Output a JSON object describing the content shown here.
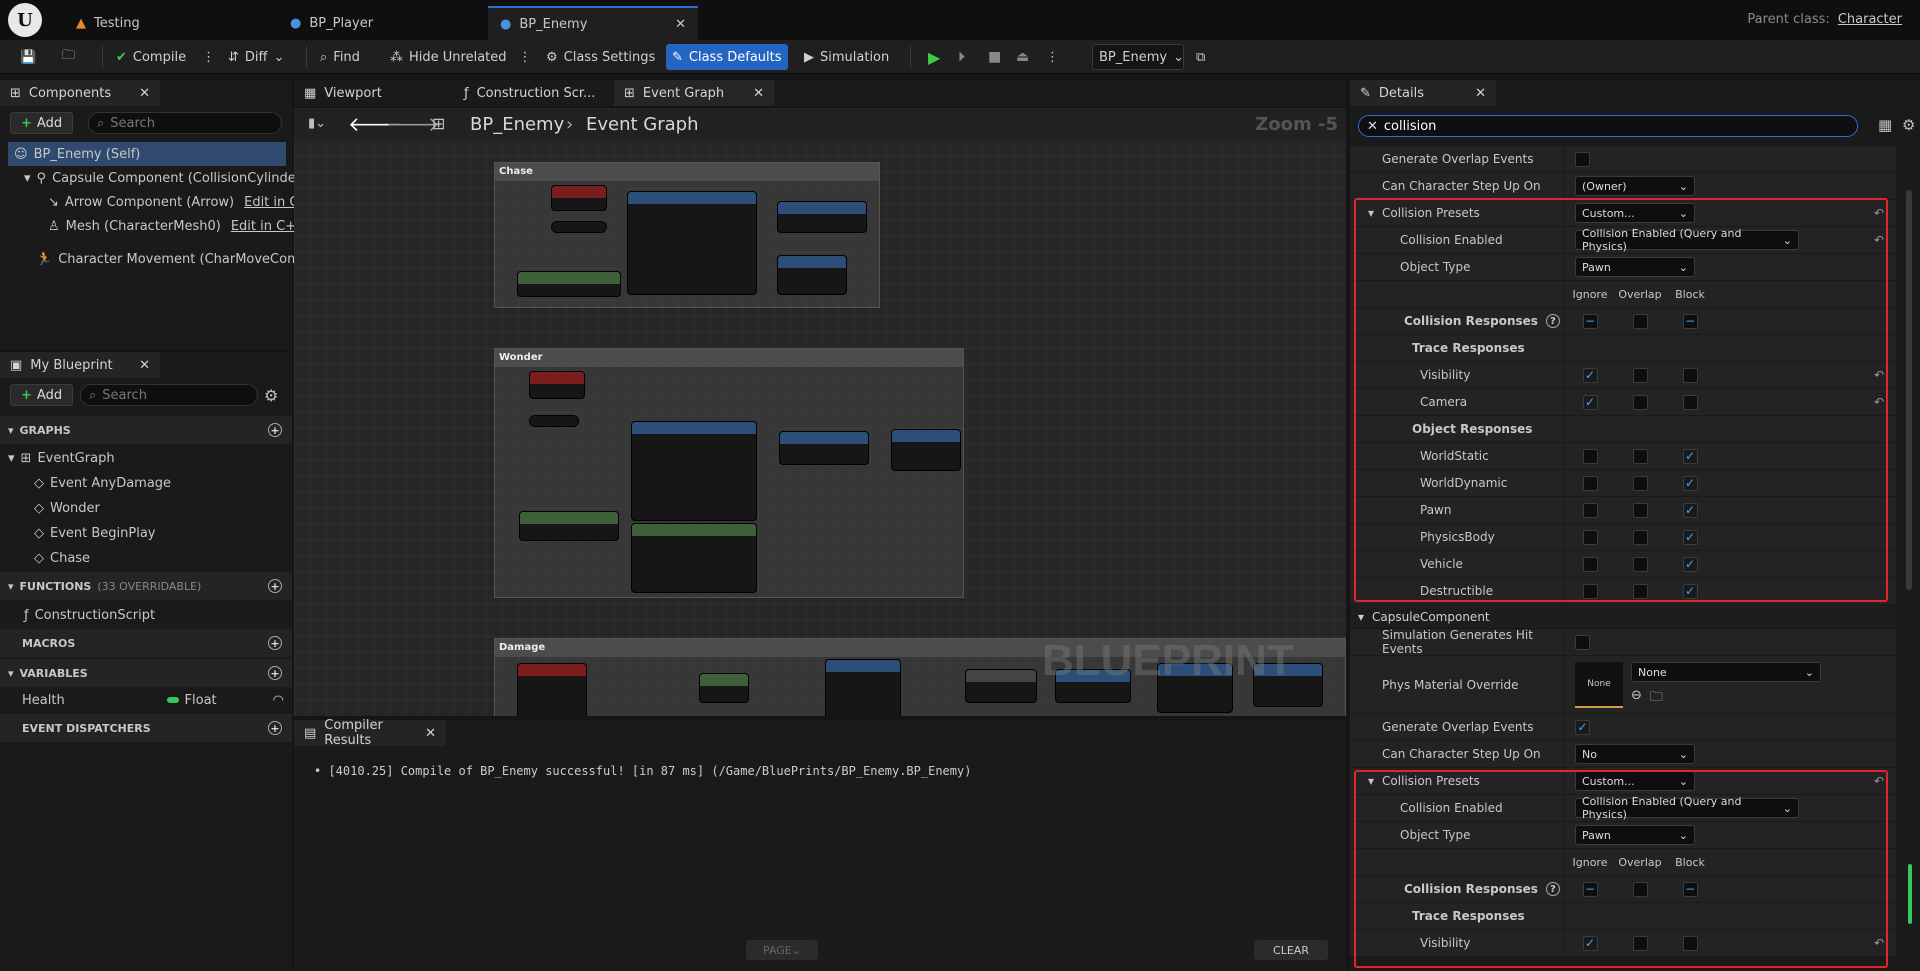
{
  "titlebar": {
    "tabs": [
      {
        "label": "Testing"
      },
      {
        "label": "BP_Player"
      },
      {
        "label": "BP_Enemy"
      }
    ],
    "parent_class_label": "Parent class:",
    "parent_class_value": "Character"
  },
  "toolbar": {
    "compile": "Compile",
    "diff": "Diff",
    "find": "Find",
    "hide_unrelated": "Hide Unrelated",
    "class_settings": "Class Settings",
    "class_defaults": "Class Defaults",
    "simulation": "Simulation",
    "debug_object": "BP_Enemy"
  },
  "components": {
    "tab": "Components",
    "add": "Add",
    "search_placeholder": "Search",
    "items": [
      {
        "label": "BP_Enemy (Self)"
      },
      {
        "label": "Capsule Component (CollisionCylinder)"
      },
      {
        "label": "Arrow Component (Arrow)",
        "link": "Edit in C++"
      },
      {
        "label": "Mesh (CharacterMesh0)",
        "link": "Edit in C++"
      },
      {
        "label": "Character Movement (CharMoveComp)"
      }
    ]
  },
  "my_blueprint": {
    "tab": "My Blueprint",
    "add": "Add",
    "search_placeholder": "Search",
    "graphs_header": "GRAPHS",
    "event_graph": "EventGraph",
    "events": [
      "Event AnyDamage",
      "Wonder",
      "Event BeginPlay",
      "Chase"
    ],
    "functions_header": "FUNCTIONS",
    "functions_note": "(33 OVERRIDABLE)",
    "functions": [
      "ConstructionScript"
    ],
    "macros_header": "MACROS",
    "variables_header": "VARIABLES",
    "variable": {
      "name": "Health",
      "type": "Float"
    },
    "dispatchers_header": "EVENT DISPATCHERS"
  },
  "graph_tabs": {
    "viewport": "Viewport",
    "construction": "Construction Scr...",
    "event_graph": "Event Graph"
  },
  "graph": {
    "breadcrumb_bp": "BP_Enemy",
    "breadcrumb_graph": "Event Graph",
    "zoom": "Zoom -5",
    "watermark": "BLUEPRINT",
    "comments": [
      "Chase",
      "Wonder",
      "Damage"
    ]
  },
  "compiler": {
    "tab": "Compiler Results",
    "message": "[4010.25] Compile of BP_Enemy successful! [in 87 ms] (/Game/BluePrints/BP_Enemy.BP_Enemy)",
    "page": "PAGE",
    "clear": "CLEAR"
  },
  "details": {
    "tab": "Details",
    "search_value": "collision",
    "rows_top": [
      {
        "name": "Generate Overlap Events"
      },
      {
        "name": "Can Character Step Up On",
        "value": "(Owner)"
      }
    ],
    "group1": {
      "presets_label": "Collision Presets",
      "presets_value": "Custom...",
      "enabled_label": "Collision Enabled",
      "enabled_value": "Collision Enabled (Query and Physics)",
      "object_type_label": "Object Type",
      "object_type_value": "Pawn",
      "col_ignore": "Ignore",
      "col_overlap": "Overlap",
      "col_block": "Block",
      "responses_label": "Collision Responses",
      "trace_label": "Trace Responses",
      "trace": [
        {
          "name": "Visibility",
          "state": "ignore"
        },
        {
          "name": "Camera",
          "state": "ignore"
        }
      ],
      "object_label": "Object Responses",
      "object": [
        {
          "name": "WorldStatic",
          "state": "block"
        },
        {
          "name": "WorldDynamic",
          "state": "block"
        },
        {
          "name": "Pawn",
          "state": "block"
        },
        {
          "name": "PhysicsBody",
          "state": "block"
        },
        {
          "name": "Vehicle",
          "state": "block"
        },
        {
          "name": "Destructible",
          "state": "block"
        }
      ]
    },
    "capsule_header": "CapsuleComponent",
    "capsule_rows": {
      "sim_hit": "Simulation Generates Hit Events",
      "phys_mat": "Phys Material Override",
      "phys_mat_thumb": "None",
      "phys_mat_value": "None",
      "gen_overlap": "Generate Overlap Events",
      "step_up": "Can Character Step Up On",
      "step_up_value": "No"
    },
    "group2": {
      "presets_label": "Collision Presets",
      "presets_value": "Custom...",
      "enabled_label": "Collision Enabled",
      "enabled_value": "Collision Enabled (Query and Physics)",
      "object_type_label": "Object Type",
      "object_type_value": "Pawn",
      "col_ignore": "Ignore",
      "col_overlap": "Overlap",
      "col_block": "Block",
      "responses_label": "Collision Responses",
      "trace_label": "Trace Responses",
      "visibility": "Visibility"
    }
  },
  "colors": {
    "accent": "#2565c2",
    "highlight": "#e0252b",
    "float_var": "#35c85a"
  }
}
